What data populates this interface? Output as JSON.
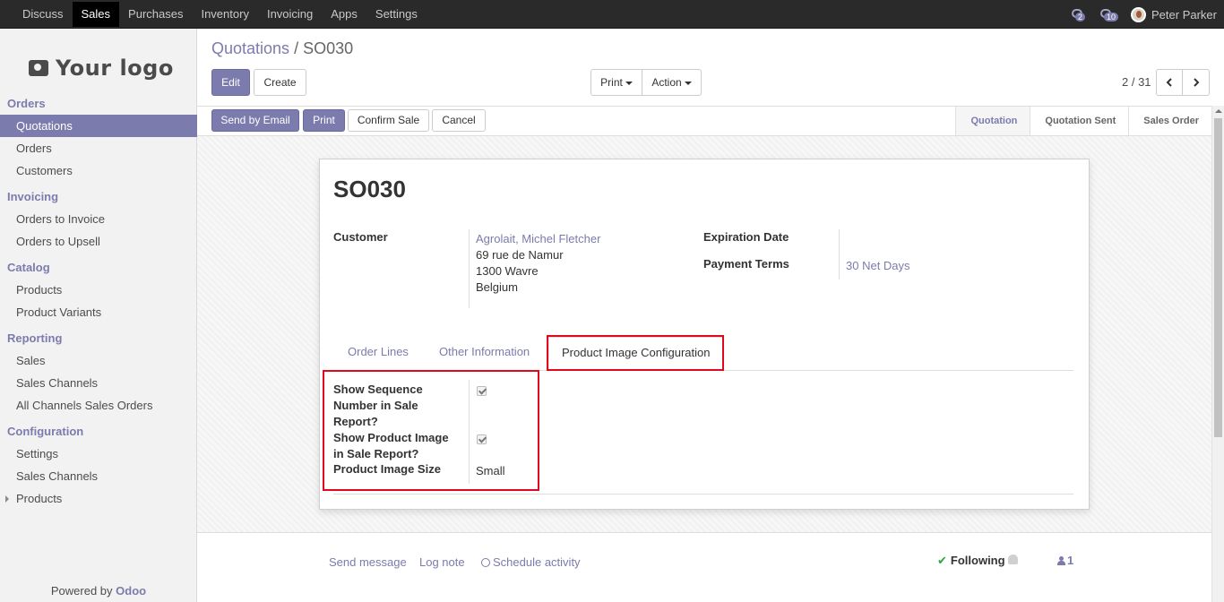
{
  "topbar": {
    "menu": [
      "Discuss",
      "Sales",
      "Purchases",
      "Inventory",
      "Invoicing",
      "Apps",
      "Settings"
    ],
    "active": "Sales",
    "activity_badge": "2",
    "messages_badge": "10",
    "user": "Peter Parker"
  },
  "sidebar": {
    "logo_text": "Your logo",
    "sections": [
      {
        "title": "Orders",
        "items": [
          "Quotations",
          "Orders",
          "Customers"
        ]
      },
      {
        "title": "Invoicing",
        "items": [
          "Orders to Invoice",
          "Orders to Upsell"
        ]
      },
      {
        "title": "Catalog",
        "items": [
          "Products",
          "Product Variants"
        ]
      },
      {
        "title": "Reporting",
        "items": [
          "Sales",
          "Sales Channels",
          "All Channels Sales Orders"
        ]
      },
      {
        "title": "Configuration",
        "items": [
          "Settings",
          "Sales Channels",
          "Products"
        ]
      }
    ],
    "powered_by": "Powered by",
    "brand": "Odoo"
  },
  "breadcrumb": {
    "parent": "Quotations",
    "separator": "/",
    "current": "SO030"
  },
  "buttons": {
    "edit": "Edit",
    "create": "Create",
    "print_menu": "Print",
    "action_menu": "Action",
    "send_email": "Send by Email",
    "print": "Print",
    "confirm": "Confirm Sale",
    "cancel": "Cancel"
  },
  "pager": "2 / 31",
  "stages": [
    "Quotation",
    "Quotation Sent",
    "Sales Order"
  ],
  "active_stage": "Quotation",
  "record": {
    "name": "SO030",
    "customer_label": "Customer",
    "customer_name": "Agrolait, Michel Fletcher",
    "address": [
      "69 rue de Namur",
      "1300 Wavre",
      "Belgium"
    ],
    "expiration_label": "Expiration Date",
    "payment_terms_label": "Payment Terms",
    "payment_terms": "30 Net Days"
  },
  "tabs": [
    "Order Lines",
    "Other Information",
    "Product Image Configuration"
  ],
  "active_tab": "Product Image Configuration",
  "config": {
    "seq_label": [
      "Show Sequence",
      "Number in Sale",
      "Report?"
    ],
    "img_label": [
      "Show Product Image",
      "in Sale Report?"
    ],
    "size_label": "Product Image Size",
    "show_sequence": true,
    "show_image": true,
    "size_value": "Small"
  },
  "chatter": {
    "send_message": "Send message",
    "log_note": "Log note",
    "schedule": "Schedule activity",
    "following": "Following",
    "followers_count": "1"
  },
  "colors": {
    "brand": "#7c7bad",
    "highlight": "#e0081d",
    "topbar": "#2a2a2a"
  }
}
